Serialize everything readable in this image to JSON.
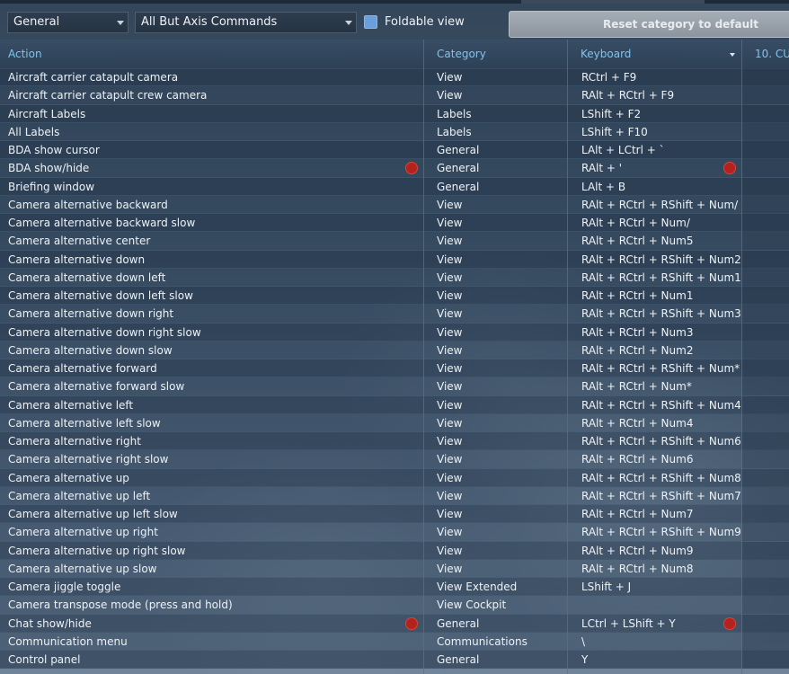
{
  "toolbar": {
    "category_dropdown": "General",
    "filter_dropdown": "All But Axis Commands",
    "foldable_view_label": "Foldable view",
    "foldable_view_checked": true,
    "reset_button_label": "Reset category to default"
  },
  "columns": {
    "action": "Action",
    "category": "Category",
    "keyboard": "Keyboard",
    "device": "10. CU"
  },
  "rows": [
    {
      "action": "Aircraft carrier catapult camera",
      "category": "View",
      "keyboard": "RCtrl + F9",
      "conflict": false
    },
    {
      "action": "Aircraft carrier catapult crew camera",
      "category": "View",
      "keyboard": "RAlt + RCtrl + F9",
      "conflict": false
    },
    {
      "action": "Aircraft Labels",
      "category": "Labels",
      "keyboard": "LShift + F2",
      "conflict": false
    },
    {
      "action": "All Labels",
      "category": "Labels",
      "keyboard": "LShift + F10",
      "conflict": false
    },
    {
      "action": "BDA show cursor",
      "category": "General",
      "keyboard": "LAlt + LCtrl + `",
      "conflict": false
    },
    {
      "action": "BDA show/hide",
      "category": "General",
      "keyboard": "RAlt + '",
      "conflict": true
    },
    {
      "action": "Briefing window",
      "category": "General",
      "keyboard": "LAlt + B",
      "conflict": false
    },
    {
      "action": "Camera alternative backward",
      "category": "View",
      "keyboard": "RAlt + RCtrl + RShift + Num/",
      "conflict": false
    },
    {
      "action": "Camera alternative backward slow",
      "category": "View",
      "keyboard": "RAlt + RCtrl + Num/",
      "conflict": false
    },
    {
      "action": "Camera alternative center",
      "category": "View",
      "keyboard": "RAlt + RCtrl + Num5",
      "conflict": false
    },
    {
      "action": "Camera alternative down",
      "category": "View",
      "keyboard": "RAlt + RCtrl + RShift + Num2",
      "conflict": false
    },
    {
      "action": "Camera alternative down left",
      "category": "View",
      "keyboard": "RAlt + RCtrl + RShift + Num1",
      "conflict": false
    },
    {
      "action": "Camera alternative down left slow",
      "category": "View",
      "keyboard": "RAlt + RCtrl + Num1",
      "conflict": false
    },
    {
      "action": "Camera alternative down right",
      "category": "View",
      "keyboard": "RAlt + RCtrl + RShift + Num3",
      "conflict": false
    },
    {
      "action": "Camera alternative down right slow",
      "category": "View",
      "keyboard": "RAlt + RCtrl + Num3",
      "conflict": false
    },
    {
      "action": "Camera alternative down slow",
      "category": "View",
      "keyboard": "RAlt + RCtrl + Num2",
      "conflict": false
    },
    {
      "action": "Camera alternative forward",
      "category": "View",
      "keyboard": "RAlt + RCtrl + RShift + Num*",
      "conflict": false
    },
    {
      "action": "Camera alternative forward slow",
      "category": "View",
      "keyboard": "RAlt + RCtrl + Num*",
      "conflict": false
    },
    {
      "action": "Camera alternative left",
      "category": "View",
      "keyboard": "RAlt + RCtrl + RShift + Num4",
      "conflict": false
    },
    {
      "action": "Camera alternative left slow",
      "category": "View",
      "keyboard": "RAlt + RCtrl + Num4",
      "conflict": false
    },
    {
      "action": "Camera alternative right",
      "category": "View",
      "keyboard": "RAlt + RCtrl + RShift + Num6",
      "conflict": false
    },
    {
      "action": "Camera alternative right slow",
      "category": "View",
      "keyboard": "RAlt + RCtrl + Num6",
      "conflict": false
    },
    {
      "action": "Camera alternative up",
      "category": "View",
      "keyboard": "RAlt + RCtrl + RShift + Num8",
      "conflict": false
    },
    {
      "action": "Camera alternative up left",
      "category": "View",
      "keyboard": "RAlt + RCtrl + RShift + Num7",
      "conflict": false
    },
    {
      "action": "Camera alternative up left slow",
      "category": "View",
      "keyboard": "RAlt + RCtrl + Num7",
      "conflict": false
    },
    {
      "action": "Camera alternative up right",
      "category": "View",
      "keyboard": "RAlt + RCtrl + RShift + Num9",
      "conflict": false
    },
    {
      "action": "Camera alternative up right slow",
      "category": "View",
      "keyboard": "RAlt + RCtrl + Num9",
      "conflict": false
    },
    {
      "action": "Camera alternative up slow",
      "category": "View",
      "keyboard": "RAlt + RCtrl + Num8",
      "conflict": false
    },
    {
      "action": "Camera jiggle toggle",
      "category": "View Extended",
      "keyboard": "LShift + J",
      "conflict": false
    },
    {
      "action": "Camera transpose mode (press and hold)",
      "category": "View Cockpit",
      "keyboard": "",
      "conflict": false
    },
    {
      "action": "Chat show/hide",
      "category": "General",
      "keyboard": "LCtrl + LShift + Y",
      "conflict": true
    },
    {
      "action": "Communication menu",
      "category": "Communications",
      "keyboard": "\\",
      "conflict": false
    },
    {
      "action": "Control panel",
      "category": "General",
      "keyboard": "Y",
      "conflict": false
    }
  ],
  "colors": {
    "header_text": "#7ec4ef",
    "conflict_icon": "#b3221c",
    "checkbox": "#6a9fdc"
  },
  "icons": {
    "conflict": "warning-dot-icon",
    "dropdown": "chevron-down-icon",
    "sort": "sort-caret-icon"
  }
}
